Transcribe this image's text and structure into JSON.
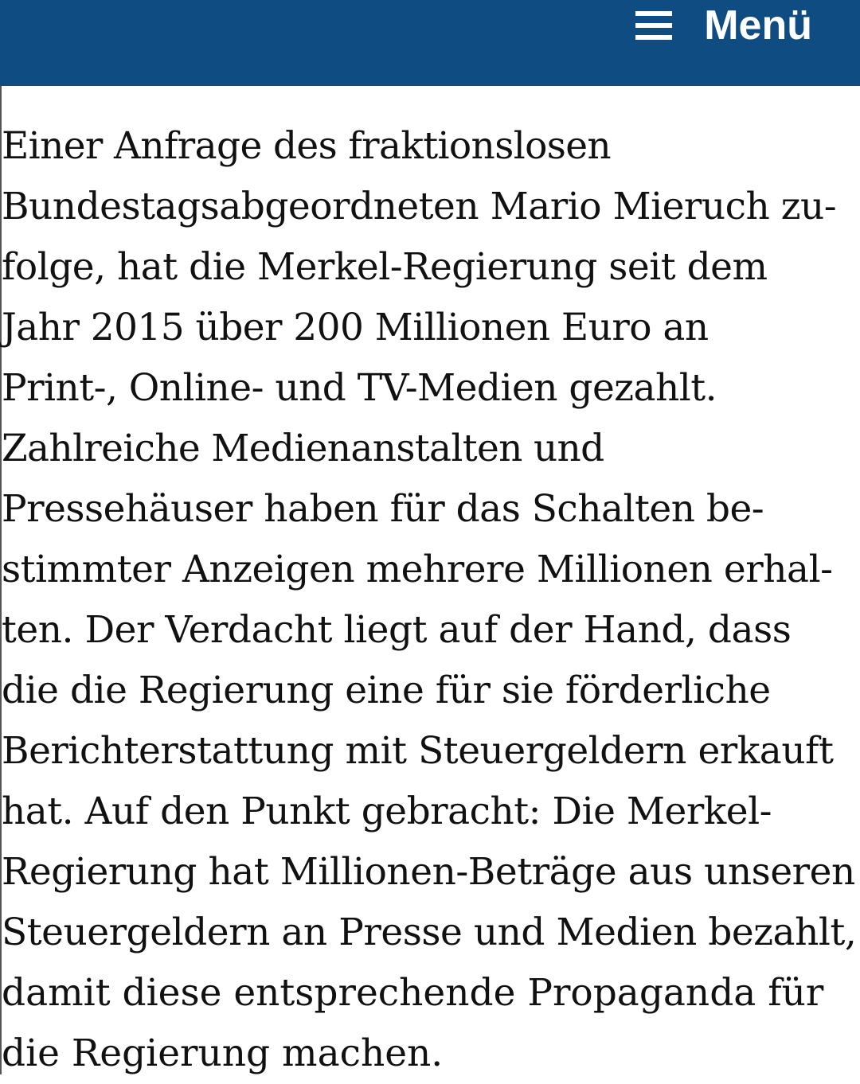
{
  "header": {
    "menu_label": "Menü",
    "menu_icon": "hamburger-menu-icon",
    "background_color": "#0f4c81"
  },
  "article": {
    "lines": [
      "Einer Anfrage des fraktionslosen",
      "Bundestagsabgeordneten Mario Mieruch zu-",
      "folge, hat die Merkel-Regierung seit dem",
      "Jahr 2015 über 200 Millionen Euro an",
      "Print-, Online- und TV-Medien gezahlt.",
      "Zahlreiche Medienanstalten und",
      "Pressehäuser haben für das Schalten be-",
      "stimmter Anzeigen mehrere Millionen erhal-",
      "ten. Der Verdacht liegt auf der Hand, dass",
      "die die Regierung eine für sie förderliche",
      "Berichterstattung mit Steuergeldern erkauft",
      "hat. Auf den Punkt gebracht: Die Merkel-",
      "Regierung hat Millionen-Beträge aus unseren",
      "Steuergeldern an Presse und Medien bezahlt,",
      "damit diese entsprechende Propaganda für",
      "die Regierung machen."
    ]
  }
}
